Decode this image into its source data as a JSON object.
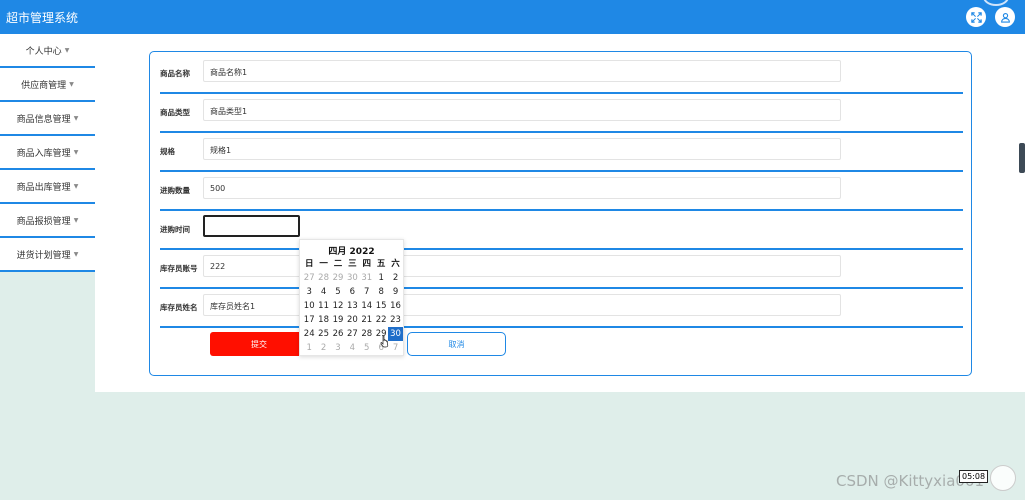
{
  "app": {
    "title": "超市管理系统"
  },
  "header": {
    "icons": [
      "fullscreen-icon",
      "user-icon"
    ]
  },
  "sidebar": {
    "items": [
      {
        "label": "个人中心"
      },
      {
        "label": "供应商管理"
      },
      {
        "label": "商品信息管理"
      },
      {
        "label": "商品入库管理"
      },
      {
        "label": "商品出库管理"
      },
      {
        "label": "商品报损管理"
      },
      {
        "label": "进货计划管理"
      }
    ]
  },
  "form": {
    "fields": [
      {
        "label": "商品名称",
        "value": "商品名称1"
      },
      {
        "label": "商品类型",
        "value": "商品类型1"
      },
      {
        "label": "规格",
        "value": "规格1"
      },
      {
        "label": "进购数量",
        "value": "500"
      },
      {
        "label": "进购时间",
        "value": ""
      },
      {
        "label": "库存员账号",
        "value": "222"
      },
      {
        "label": "库存员姓名",
        "value": "库存员姓名1"
      }
    ],
    "submit_label": "提交",
    "cancel_label": "取消"
  },
  "datepicker": {
    "title": "四月 2022",
    "weekdays": [
      "日",
      "一",
      "二",
      "三",
      "四",
      "五",
      "六"
    ],
    "weeks": [
      [
        "27",
        "28",
        "29",
        "30",
        "31",
        "1",
        "2"
      ],
      [
        "3",
        "4",
        "5",
        "6",
        "7",
        "8",
        "9"
      ],
      [
        "10",
        "11",
        "12",
        "13",
        "14",
        "15",
        "16"
      ],
      [
        "17",
        "18",
        "19",
        "20",
        "21",
        "22",
        "23"
      ],
      [
        "24",
        "25",
        "26",
        "27",
        "28",
        "29",
        "30"
      ],
      [
        "1",
        "2",
        "3",
        "4",
        "5",
        "6",
        "7"
      ]
    ],
    "selected": "30"
  },
  "overlay": {
    "clock": "05:08",
    "watermark": "CSDN @Kittyxia001"
  },
  "colors": {
    "primary": "#1f88e5",
    "submit": "#ff0f00",
    "selected": "#1f6ec9"
  }
}
